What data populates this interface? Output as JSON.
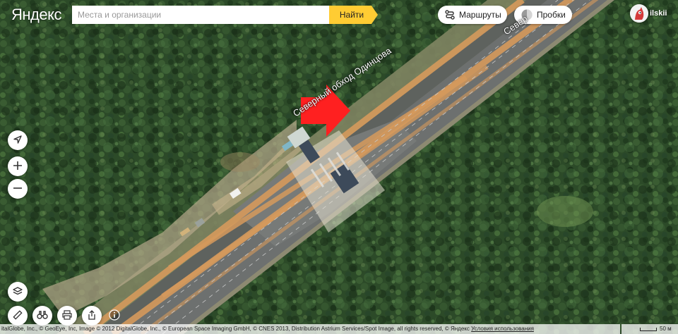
{
  "app": {
    "logo": "Яндекс"
  },
  "search": {
    "placeholder": "Места и организации",
    "button_label": "Найти"
  },
  "toolbar": {
    "routes_label": "Маршруты",
    "traffic_label": "Пробки"
  },
  "user": {
    "name": "ilskii"
  },
  "map": {
    "type": "satellite",
    "road_labels": [
      "Северный обход Одинцова",
      "Север"
    ],
    "marker": {
      "type": "arrow",
      "color": "#ff2020"
    },
    "road_color": "#d69a5c"
  },
  "controls": [
    "locate",
    "zoom-in",
    "zoom-out",
    "layers",
    "ruler",
    "panorama",
    "print",
    "share",
    "info"
  ],
  "footer": {
    "copyright": "italGlobe, Inc., © GeoEye, Inc, Image © 2012 DigitalGlobe, Inc., © European Space Imaging GmbH, © CNES 2013, Distribution Astrium Services/Spot Image, all rights reserved, © Яндекс",
    "terms_link": "Условия использования",
    "scale_label": "50 м"
  }
}
